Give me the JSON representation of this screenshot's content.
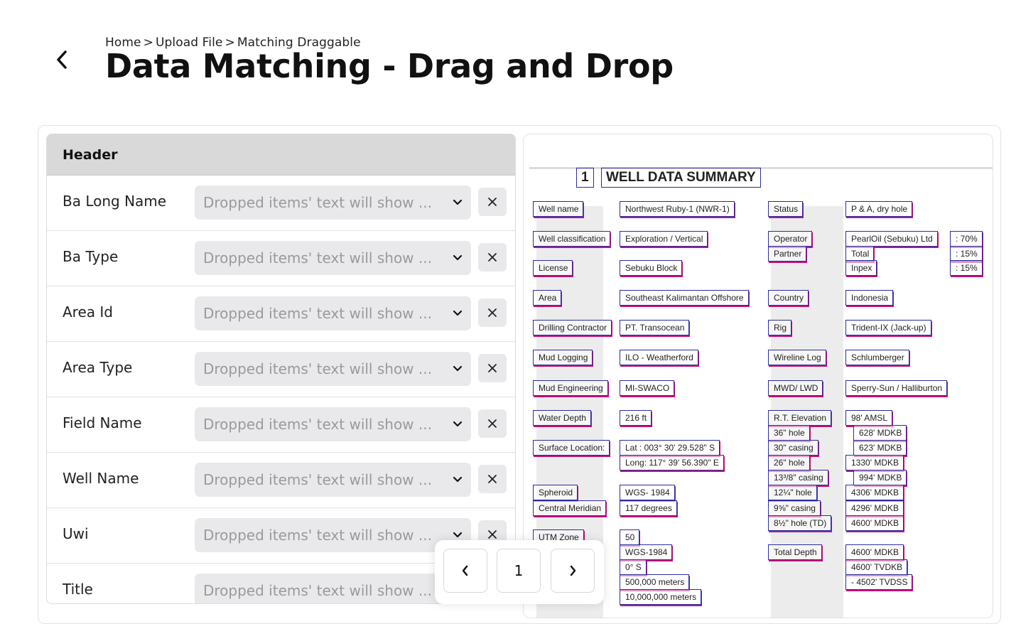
{
  "breadcrumb": [
    "Home",
    ">",
    "Upload File",
    ">",
    "Matching Draggable"
  ],
  "page_title": "Data Matching - Drag and Drop",
  "panel": {
    "header": "Header",
    "placeholder": "Dropped items' text will show ...",
    "fields": [
      "Ba Long Name",
      "Ba Type",
      "Area Id",
      "Area Type",
      "Field Name",
      "Well Name",
      "Uwi",
      "Title"
    ]
  },
  "pagination": {
    "current_page": "1"
  },
  "document": {
    "section_number": "1",
    "section_title": "WELL DATA SUMMARY",
    "labels_left": [
      "Well name",
      "Well classification",
      "License",
      "Area",
      "Drilling Contractor",
      "Mud Logging",
      "Mud Engineering",
      "Water Depth",
      "Surface Location:",
      "Spheroid",
      "Central Meridian",
      "UTM Zone"
    ],
    "values_left": [
      "Northwest Ruby-1 (NWR-1)",
      "Exploration / Vertical",
      "Sebuku Block",
      "Southeast Kalimantan Offshore",
      "PT. Transocean",
      "ILO - Weatherford",
      "MI-SWACO",
      "216 ft",
      "Lat   : 003° 30' 29.528\" S",
      "Long: 117° 39' 56.390\" E",
      "WGS- 1984",
      "117 degrees",
      "50",
      "WGS-1984",
      "0° S",
      "500,000 meters",
      "10,000,000 meters"
    ],
    "labels_right": [
      "Status",
      "Operator",
      "Partner",
      "Country",
      "Rig",
      "Wireline Log",
      "MWD/ LWD",
      "R.T. Elevation",
      "36\" hole",
      "30\" casing",
      "26\" hole",
      "13³/8\" casing",
      "12¼\" hole",
      "9⅝\" casing",
      "8½\" hole (TD)",
      "Total Depth"
    ],
    "values_right": [
      "P & A, dry hole",
      "PearlOil (Sebuku) Ltd",
      "Total",
      "Inpex",
      "Indonesia",
      "Trident-IX (Jack-up)",
      "Schlumberger",
      "Sperry-Sun / Halliburton",
      "98' AMSL",
      "628' MDKB",
      "623' MDKB",
      "1330' MDKB",
      "994' MDKB",
      "4306' MDKB",
      "4296' MDKB",
      "4600' MDKB",
      "4600' MDKB",
      "4600' TVDKB",
      "- 4502' TVDSS"
    ],
    "shares": [
      ": 70%",
      ": 15%",
      ": 15%"
    ]
  }
}
